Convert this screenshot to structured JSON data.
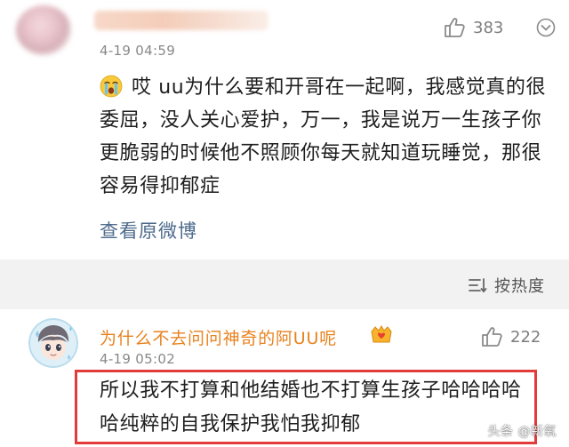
{
  "top_comment": {
    "time": "4-19 04:59",
    "like_count": "383",
    "text": "哎 uu为什么要和开哥在一起啊，我感觉真的很委屈，没人关心爱护，万一，我是说万一生孩子你更脆弱的时候他不照顾你每天就知道玩睡觉，那很容易得抑郁症",
    "view_original": "查看原微博",
    "emoji": "crying-face-icon"
  },
  "sort_bar": {
    "label": "按热度"
  },
  "reply": {
    "username": "为什么不去问问神奇的阿UU呢",
    "time": "4-19 05:02",
    "like_count": "222",
    "text": "所以我不打算和他结婚也不打算生孩子哈哈哈哈哈纯粹的自我保护我怕我抑郁"
  },
  "watermark": "头条 @新氧",
  "colors": {
    "username": "#e8821e",
    "link": "#4e6b8c",
    "highlight_border": "#e33a3a",
    "sort_bar_bg": "#f2f2f2"
  }
}
